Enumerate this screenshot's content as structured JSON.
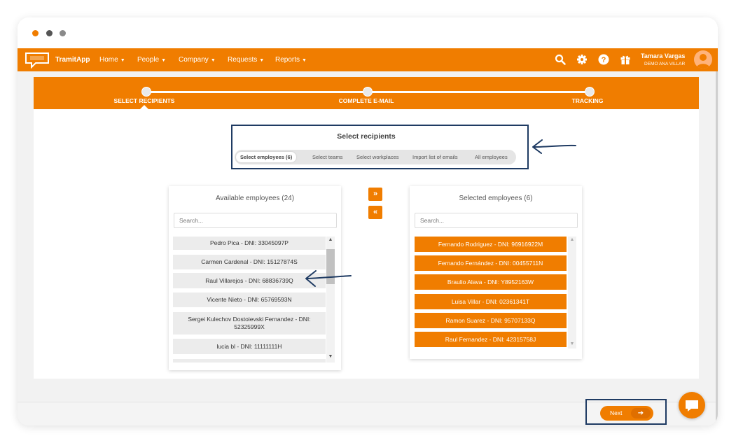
{
  "nav": {
    "logo_text": "TramitApp",
    "menu": [
      {
        "label": "Home"
      },
      {
        "label": "People"
      },
      {
        "label": "Company"
      },
      {
        "label": "Requests"
      },
      {
        "label": "Reports"
      }
    ],
    "user_name": "Tamara Vargas",
    "user_company": "DEMO ANA VILLAR"
  },
  "stepper": {
    "steps": [
      {
        "label": "SELECT RECIPIENTS",
        "active": true
      },
      {
        "label": "COMPLETE E-MAIL",
        "active": false
      },
      {
        "label": "TRACKING",
        "active": false
      }
    ]
  },
  "recipients": {
    "title": "Select recipients",
    "tabs": [
      {
        "label": "Select employees (6)",
        "active": true
      },
      {
        "label": "Select teams",
        "active": false
      },
      {
        "label": "Select workplaces",
        "active": false
      },
      {
        "label": "Import list of emails",
        "active": false
      },
      {
        "label": "All employees",
        "active": false
      }
    ]
  },
  "available": {
    "title": "Available employees (24)",
    "search_placeholder": "Search...",
    "items": [
      "Pedro Pica - DNI: 33045097P",
      "Carmen Cardenal - DNI: 15127874S",
      "Raul Villarejos - DNI: 68836739Q",
      "Vicente Nieto - DNI: 65769593N",
      "Sergei Kulechov Dostoievski Fernandez - DNI: 52325999X",
      "lucia bl - DNI: 11111111H"
    ]
  },
  "selected": {
    "title": "Selected employees (6)",
    "search_placeholder": "Search...",
    "items": [
      "Fernando Rodriguez - DNI: 96916922M",
      "Fernando Fernández - DNI: 00455711N",
      "Braulio Alava - DNI: Y8952163W",
      "Luisa Villar - DNI: 02361341T",
      "Ramon Suarez - DNI: 95707133Q",
      "Raul Fernandez - DNI: 42315758J"
    ]
  },
  "controls": {
    "move_right_symbol": "»",
    "move_left_symbol": "«",
    "next_label": "Next",
    "next_arrow_symbol": "➔"
  },
  "colors": {
    "brand": "#f07d00",
    "annotation": "#1f3b63"
  },
  "icons": [
    "search-icon",
    "gear-icon",
    "help-icon",
    "gift-icon",
    "chat-icon"
  ]
}
